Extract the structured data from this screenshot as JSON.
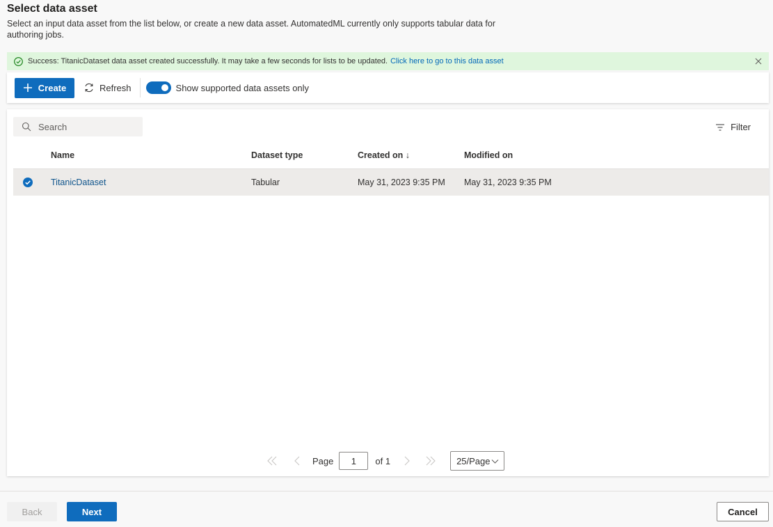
{
  "header": {
    "title": "Select data asset",
    "description": "Select an input data asset from the list below, or create a new data asset. AutomatedML currently only supports tabular data for authoring jobs."
  },
  "banner": {
    "message": "Success: TitanicDataset data asset created successfully. It may take a few seconds for lists to be updated.",
    "link": "Click here to go to this data asset",
    "icon": "success-check-icon",
    "close_icon": "close-icon"
  },
  "toolbar": {
    "create_label": "Create",
    "refresh_label": "Refresh",
    "toggle_label": "Show supported data assets only",
    "toggle_on": true
  },
  "search": {
    "placeholder": "Search"
  },
  "filter_label": "Filter",
  "table": {
    "columns": [
      "Name",
      "Dataset type",
      "Created on ↓",
      "Modified on"
    ],
    "rows": [
      {
        "selected": true,
        "name": "TitanicDataset",
        "dataset_type": "Tabular",
        "created_on": "May 31, 2023 9:35 PM",
        "modified_on": "May 31, 2023 9:35 PM"
      }
    ]
  },
  "pagination": {
    "page_label": "Page",
    "current_page": "1",
    "of_label": "of 1",
    "page_size": "25/Page"
  },
  "footer": {
    "back_label": "Back",
    "next_label": "Next",
    "cancel_label": "Cancel"
  },
  "colors": {
    "accent": "#0f6cbd",
    "success_bg": "#dff6dd",
    "success_icon": "#107c10",
    "selected_row": "#edebe9"
  }
}
